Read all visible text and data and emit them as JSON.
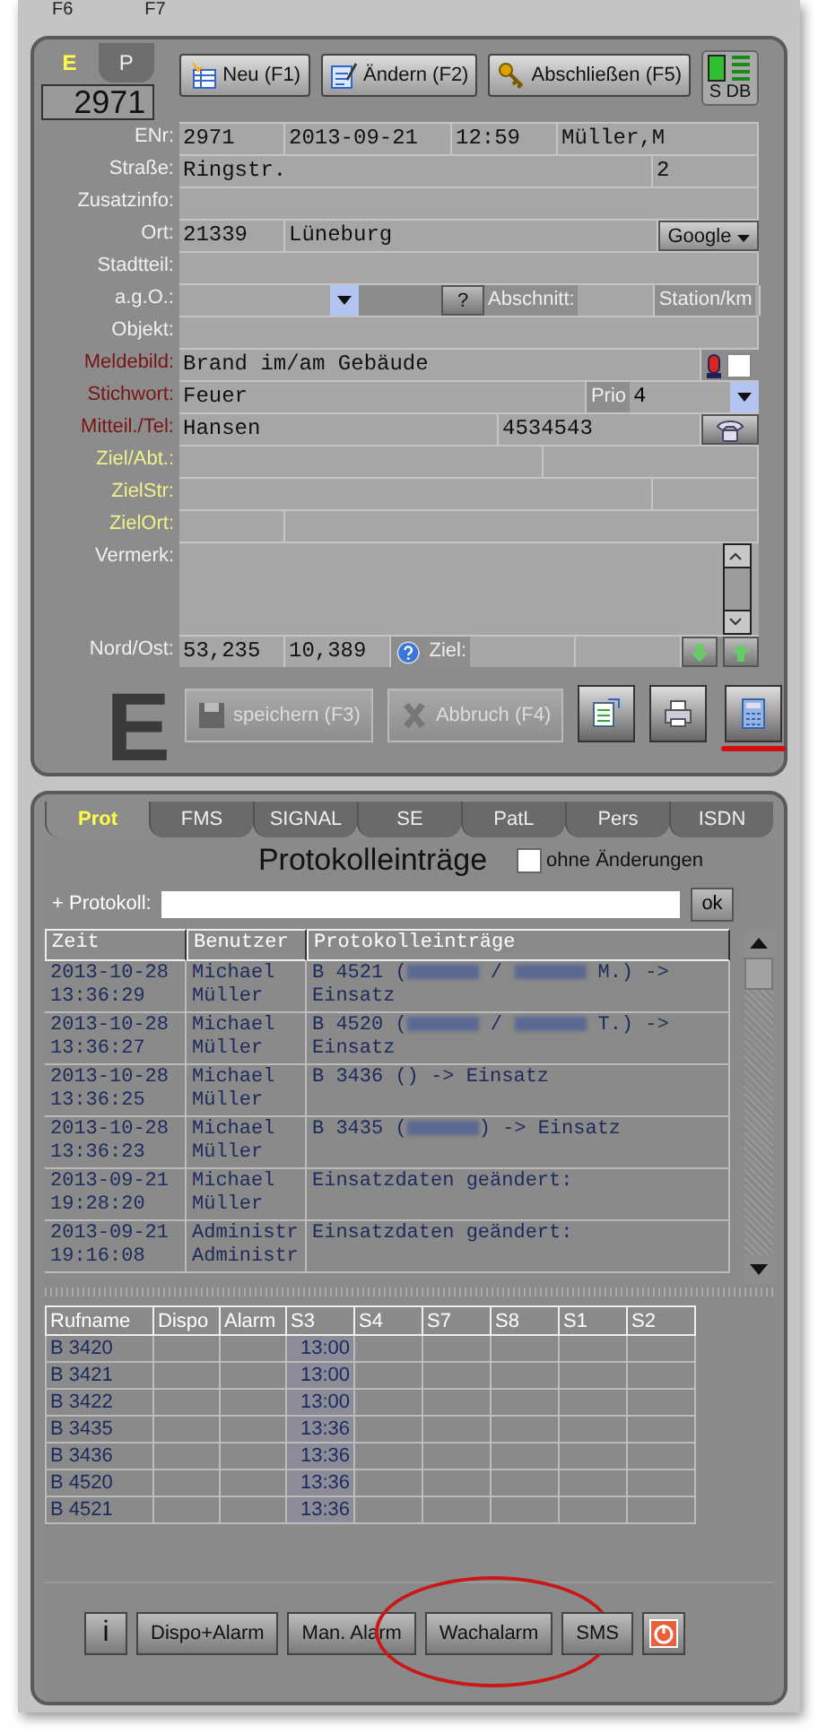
{
  "fkeys": [
    "F6",
    "F7"
  ],
  "mode_tabs": [
    {
      "label": "E",
      "selected": true
    },
    {
      "label": "P",
      "selected": false
    }
  ],
  "incident_number": "2971",
  "toolbar": [
    {
      "kind": "new",
      "label": "Neu (F1)"
    },
    {
      "kind": "edit",
      "label": "Ändern (F2)"
    },
    {
      "kind": "close",
      "label": "Abschließen (F5)"
    }
  ],
  "status_indicator": {
    "label": "S DB",
    "on": true
  },
  "form_rows": [
    {
      "label": "ENr:",
      "color": "#f0f0f0",
      "fields": [
        {
          "kind": "text",
          "value": "2971"
        },
        {
          "kind": "text",
          "value": "2013-09-21"
        },
        {
          "kind": "text",
          "value": "12:59"
        },
        {
          "kind": "text",
          "value": "Müller,M"
        }
      ]
    },
    {
      "label": "Straße:",
      "color": "#f0f0f0",
      "fields": [
        {
          "kind": "text",
          "value": "Ringstr."
        },
        {
          "kind": "text",
          "value": "2"
        }
      ]
    },
    {
      "label": "Zusatzinfo:",
      "color": "#f0f0f0",
      "fields": [
        {
          "kind": "text"
        }
      ]
    },
    {
      "label": "Ort:",
      "color": "#f0f0f0",
      "fields": [
        {
          "kind": "text",
          "value": "21339"
        },
        {
          "kind": "text",
          "value": "Lüneburg"
        },
        {
          "kind": "dropdown",
          "label": "Google"
        }
      ]
    },
    {
      "label": "Stadtteil:",
      "color": "#f0f0f0",
      "fields": [
        {
          "kind": "text"
        }
      ]
    },
    {
      "label": "a.g.O.:",
      "color": "#f0f0f0",
      "fields": [
        {
          "kind": "combo"
        },
        {
          "kind": "button",
          "label": "?"
        },
        {
          "kind": "label",
          "label": "Abschnitt:"
        },
        {
          "kind": "text"
        },
        {
          "kind": "label",
          "label": "Station/km"
        },
        {
          "kind": "text"
        }
      ]
    },
    {
      "label": "Objekt:",
      "color": "#f0f0f0",
      "fields": [
        {
          "kind": "text"
        }
      ]
    },
    {
      "label": "Meldebild:",
      "color": "#7a1414",
      "fields": [
        {
          "kind": "text",
          "value": "Brand im/am Gebäude"
        },
        {
          "kind": "alarm"
        },
        {
          "kind": "checkbox",
          "checked": false
        }
      ]
    },
    {
      "label": "Stichwort:",
      "color": "#7a1414",
      "fields": [
        {
          "kind": "text",
          "value": "Feuer"
        },
        {
          "kind": "label",
          "label": "Prio"
        },
        {
          "kind": "combo",
          "value": "4"
        }
      ]
    },
    {
      "label": "Mitteil./Tel:",
      "color": "#7a1414",
      "fields": [
        {
          "kind": "text",
          "value": "Hansen"
        },
        {
          "kind": "text",
          "value": "4534543"
        },
        {
          "kind": "phone"
        }
      ]
    },
    {
      "label": "Ziel/Abt.:",
      "color": "#f2f28a",
      "fields": [
        {
          "kind": "text"
        },
        {
          "kind": "text"
        }
      ]
    },
    {
      "label": "ZielStr:",
      "color": "#f2f28a",
      "fields": [
        {
          "kind": "text"
        },
        {
          "kind": "text"
        }
      ]
    },
    {
      "label": "ZielOrt:",
      "color": "#f2f28a",
      "fields": [
        {
          "kind": "text"
        },
        {
          "kind": "text"
        }
      ]
    },
    {
      "label": "Vermerk:",
      "color": "#f0f0f0",
      "fields": [
        {
          "kind": "textarea"
        }
      ]
    },
    {
      "label": "Nord/Ost:",
      "color": "#f0f0f0",
      "fields": [
        {
          "kind": "text",
          "value": "53,235"
        },
        {
          "kind": "text",
          "value": "10,389"
        },
        {
          "kind": "help"
        },
        {
          "kind": "label",
          "label": "Ziel:"
        },
        {
          "kind": "text"
        },
        {
          "kind": "text"
        },
        {
          "kind": "down"
        },
        {
          "kind": "up"
        }
      ]
    }
  ],
  "big_letter": "E",
  "actions": [
    {
      "kind": "save",
      "label": "speichern (F3)",
      "disabled": true
    },
    {
      "kind": "cancel",
      "label": "Abbruch (F4)",
      "disabled": true
    },
    {
      "kind": "export",
      "disabled": false
    },
    {
      "kind": "print",
      "disabled": false
    },
    {
      "kind": "calculator",
      "disabled": false,
      "underlined": true
    }
  ],
  "tabs": [
    {
      "label": "Prot",
      "selected": true
    },
    {
      "label": "FMS",
      "selected": false
    },
    {
      "label": "SIGNAL",
      "selected": false
    },
    {
      "label": "SE",
      "selected": false
    },
    {
      "label": "PatL",
      "selected": false
    },
    {
      "label": "Pers",
      "selected": false
    },
    {
      "label": "ISDN",
      "selected": false
    }
  ],
  "protocol": {
    "title": "Protokolleinträge",
    "filter": {
      "label": "ohne Änderungen",
      "checked": false
    },
    "input_label": "+ Protokoll:",
    "ok": "ok",
    "columns": [
      "Zeit",
      "Benutzer",
      "Protokolleinträge"
    ],
    "rows": [
      {
        "time": [
          "2013-10-28",
          "13:36:29"
        ],
        "user": [
          "Michael",
          "Müller"
        ],
        "entry": [
          {
            "kind": "text",
            "text": "B 4521 ("
          },
          {
            "kind": "redacted"
          },
          {
            "kind": "text",
            "text": " / "
          },
          {
            "kind": "redacted"
          },
          {
            "kind": "text",
            "text": " M.) -> Einsatz"
          }
        ]
      },
      {
        "time": [
          "2013-10-28",
          "13:36:27"
        ],
        "user": [
          "Michael",
          "Müller"
        ],
        "entry": [
          {
            "kind": "text",
            "text": "B 4520 ("
          },
          {
            "kind": "redacted"
          },
          {
            "kind": "text",
            "text": " / "
          },
          {
            "kind": "redacted"
          },
          {
            "kind": "text",
            "text": " T.) -> Einsatz"
          }
        ]
      },
      {
        "time": [
          "2013-10-28",
          "13:36:25"
        ],
        "user": [
          "Michael",
          "Müller"
        ],
        "entry": [
          {
            "kind": "text",
            "text": "B 3436 () -> Einsatz"
          }
        ]
      },
      {
        "time": [
          "2013-10-28",
          "13:36:23"
        ],
        "user": [
          "Michael",
          "Müller"
        ],
        "entry": [
          {
            "kind": "text",
            "text": "B 3435 ("
          },
          {
            "kind": "redacted"
          },
          {
            "kind": "text",
            "text": ") -> Einsatz"
          }
        ]
      },
      {
        "time": [
          "2013-09-21",
          "19:28:20"
        ],
        "user": [
          "Michael",
          "Müller"
        ],
        "entry": [
          {
            "kind": "text",
            "text": "Einsatzdaten geändert:"
          }
        ]
      },
      {
        "time": [
          "2013-09-21",
          "19:16:08"
        ],
        "user": [
          "Administr",
          "Administr"
        ],
        "entry": [
          {
            "kind": "text",
            "text": "Einsatzdaten geändert:"
          }
        ]
      }
    ]
  },
  "units": {
    "columns": [
      "Rufname",
      "Dispo",
      "Alarm",
      "S3",
      "S4",
      "S7",
      "S8",
      "S1",
      "S2"
    ],
    "rows": [
      [
        "B 3420",
        "",
        "",
        "13:00",
        "",
        "",
        "",
        "",
        ""
      ],
      [
        "B 3421",
        "",
        "",
        "13:00",
        "",
        "",
        "",
        "",
        ""
      ],
      [
        "B 3422",
        "",
        "",
        "13:00",
        "",
        "",
        "",
        "",
        ""
      ],
      [
        "B 3435",
        "",
        "",
        "13:36",
        "",
        "",
        "",
        "",
        ""
      ],
      [
        "B 3436",
        "",
        "",
        "13:36",
        "",
        "",
        "",
        "",
        ""
      ],
      [
        "B 4520",
        "",
        "",
        "13:36",
        "",
        "",
        "",
        "",
        ""
      ],
      [
        "B 4521",
        "",
        "",
        "13:36",
        "",
        "",
        "",
        "",
        ""
      ]
    ]
  },
  "bottom_buttons": [
    {
      "kind": "info",
      "label": "i"
    },
    {
      "kind": "text",
      "label": "Dispo+Alarm"
    },
    {
      "kind": "text",
      "label": "Man. Alarm"
    },
    {
      "kind": "text",
      "label": "Wachalarm",
      "circled": true
    },
    {
      "kind": "text",
      "label": "SMS"
    },
    {
      "kind": "power"
    }
  ]
}
